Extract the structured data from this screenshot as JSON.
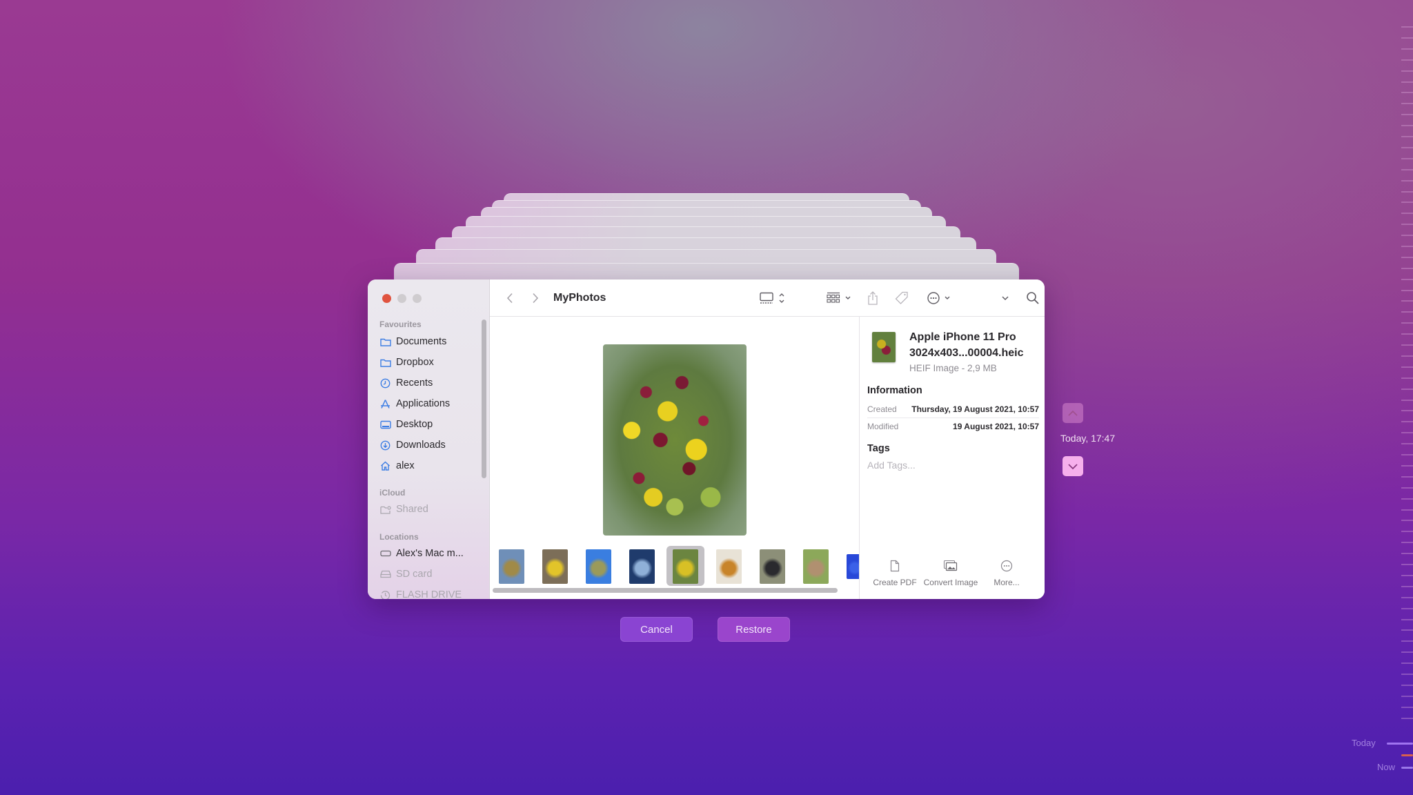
{
  "window": {
    "title": "MyPhotos",
    "traffic_lights": [
      "close",
      "minimize",
      "zoom"
    ]
  },
  "toolbar": {
    "back_icon": "chevron-left-icon",
    "forward_icon": "chevron-right-icon",
    "view_icon": "gallery-view-icon",
    "group_icon": "grid-group-icon",
    "share_icon": "share-icon",
    "tag_icon": "tag-icon",
    "more_icon": "ellipsis-circle-icon",
    "overflow_icon": "chevron-down-icon",
    "search_icon": "search-icon"
  },
  "sidebar": {
    "sections": [
      {
        "label": "Favourites",
        "items": [
          {
            "label": "Documents",
            "icon": "folder-icon"
          },
          {
            "label": "Dropbox",
            "icon": "folder-icon"
          },
          {
            "label": "Recents",
            "icon": "clock-icon"
          },
          {
            "label": "Applications",
            "icon": "applications-icon"
          },
          {
            "label": "Desktop",
            "icon": "desktop-icon"
          },
          {
            "label": "Downloads",
            "icon": "download-icon"
          },
          {
            "label": "alex",
            "icon": "home-icon"
          }
        ]
      },
      {
        "label": "iCloud",
        "items": [
          {
            "label": "Shared",
            "icon": "shared-folder-icon",
            "dimmed": true
          }
        ]
      },
      {
        "label": "Locations",
        "items": [
          {
            "label": "Alex's Mac m...",
            "icon": "drive-icon"
          },
          {
            "label": "SD card",
            "icon": "external-drive-icon",
            "dimmed": true
          },
          {
            "label": "FLASH DRIVE",
            "icon": "time-machine-icon",
            "dimmed": true
          }
        ]
      }
    ]
  },
  "gallery": {
    "thumbnails": [
      {
        "subject": "macarons",
        "colors": [
          "#6f8fb8",
          "#a08a48"
        ]
      },
      {
        "subject": "yellow flowers",
        "colors": [
          "#7c6e58",
          "#e2c42a"
        ]
      },
      {
        "subject": "jellyfish",
        "colors": [
          "#3a7ee0",
          "#9a9a5a"
        ]
      },
      {
        "subject": "ice cave",
        "colors": [
          "#1f3b6c",
          "#8fb0d8"
        ]
      },
      {
        "subject": "salad",
        "colors": [
          "#6b8540",
          "#d8c025"
        ],
        "selected": true
      },
      {
        "subject": "tart",
        "colors": [
          "#e8e2d6",
          "#c8842a"
        ]
      },
      {
        "subject": "cat in forest",
        "colors": [
          "#8c8f78",
          "#2a2a2e"
        ]
      },
      {
        "subject": "garden",
        "colors": [
          "#8ca85a",
          "#b09070"
        ]
      },
      {
        "subject": "jellyfish",
        "colors": [
          "#2848d8",
          "#3a60e8"
        ]
      }
    ]
  },
  "info_panel": {
    "file_name_line1": "Apple iPhone 11 Pro",
    "file_name_line2": "3024x403...00004.heic",
    "file_kind": "HEIF Image - 2,9 MB",
    "information_heading": "Information",
    "created_label": "Created",
    "created_value": "Thursday, 19 August 2021, 10:57",
    "modified_label": "Modified",
    "modified_value": "19 August 2021, 10:57",
    "tags_heading": "Tags",
    "tags_placeholder": "Add Tags...",
    "actions": [
      {
        "label": "Create PDF",
        "icon": "document-icon"
      },
      {
        "label": "Convert Image",
        "icon": "photos-icon"
      },
      {
        "label": "More...",
        "icon": "ellipsis-circle-icon"
      }
    ]
  },
  "buttons": {
    "cancel": "Cancel",
    "restore": "Restore"
  },
  "time_machine": {
    "current_snapshot": "Today, 17:47",
    "timeline_today": "Today",
    "timeline_now": "Now",
    "accent_color": "#f6b0ec"
  }
}
